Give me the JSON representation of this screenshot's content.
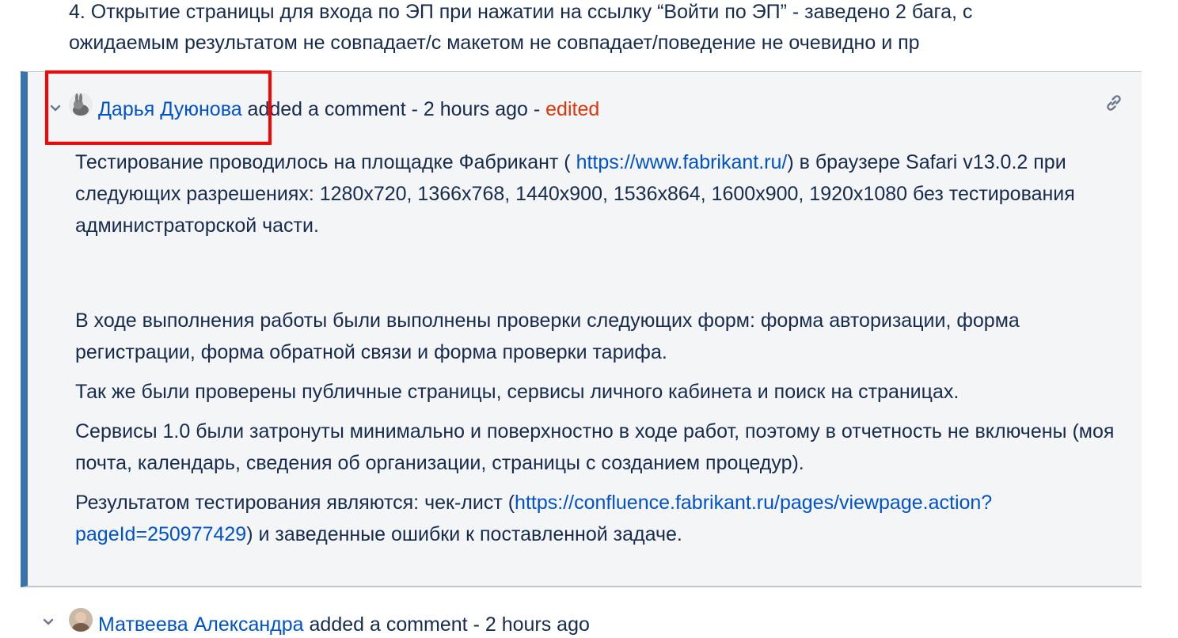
{
  "top_text": {
    "line1": "4. Открытие страницы для входа по ЭП при нажатии на ссылку “Войти по ЭП” - заведено 2 бага, с",
    "line2": "ожидаемым результатом не совпадает/с макетом не совпадает/поведение не очевидно и пр"
  },
  "comment1": {
    "author": "Дарья Дуюнова",
    "action": " added a comment - 2 hours ago - ",
    "edited": "edited",
    "body": {
      "p1_start": "Тестирование проводилось на площадке Фабрикант ( ",
      "p1_link": "https://www.fabrikant.ru/",
      "p1_end": ") в браузере Safari v13.0.2 при следующих разрешениях: 1280x720, 1366x768, 1440x900, 1536x864, 1600x900, 1920x1080 без тестирования администраторской части.",
      "p2": "В ходе выполнения работы были выполнены проверки следующих форм: форма авторизации, форма регистрации, форма обратной связи и форма проверки тарифа.",
      "p3": "Так же были проверены публичные страницы, сервисы личного кабинета и поиск на страницах.",
      "p4": "Сервисы 1.0 были затронуты минимально и поверхностно в ходе работ, поэтому в отчетность не включены (моя почта, календарь, сведения об организации, страницы с созданием процедур).",
      "p5_start": "Результатом тестирования являются: чек-лист (",
      "p5_link": "https://confluence.fabrikant.ru/pages/viewpage.action?pageId=250977429",
      "p5_end": ") и заведенные ошибки к поставленной задаче."
    }
  },
  "comment2": {
    "author": "Матвеева Александра",
    "action": " added a comment - 2 hours ago"
  },
  "colors": {
    "accent_border": "#3b73af",
    "link": "#0052cc",
    "edited": "#de350b",
    "highlight": "#ff0000"
  },
  "icons": [
    "chevron-down-icon",
    "avatar",
    "permalink-icon"
  ]
}
